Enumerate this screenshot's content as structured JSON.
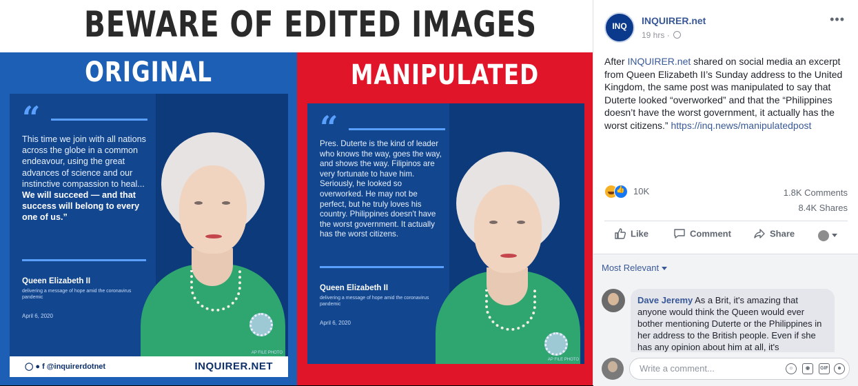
{
  "image": {
    "headline": "BEWARE OF EDITED IMAGES",
    "original_label": "ORIGINAL",
    "manipulated_label": "MANIPULATED",
    "original_card": {
      "quote_plain": "This time we join with all nations across the globe in a common endeavour, using the great advances of science and our instinctive compassion to heal...",
      "quote_bold": "We will succeed — and that success will belong to every one of us.”",
      "name": "Queen Elizabeth II",
      "subtitle": "delivering a message of hope amid the coronavirus pandemic",
      "date": "April 6, 2020",
      "credit": "AP FILE PHOTO"
    },
    "manipulated_card": {
      "quote_plain": "Pres. Duterte is the kind of leader who knows the way, goes the way, and shows the way. Filipinos are very fortunate to have him. Seriously, he looked so overworked. He may not be perfect, but he truly loves his country. Philippines doesn't have the worst government. It actually has the worst citizens.",
      "name": "Queen Elizabeth II",
      "subtitle": "delivering a message of hope amid the coronavirus pandemic",
      "date": "April 6, 2020",
      "credit": "AP FILE PHOTO"
    },
    "footer": {
      "handle": "@inquirerdotnet",
      "brand": "INQUIRER.NET"
    },
    "colors": {
      "original_bg": "#1c5fb4",
      "manipulated_bg": "#e0152a",
      "dress": "#2fa56f"
    }
  },
  "post": {
    "avatar_text": "INQ",
    "page_name": "INQUIRER.net",
    "time": "19 hrs",
    "text_pre": "After ",
    "text_link": "INQUIRER.net",
    "text_body": " shared on social media an excerpt from Queen Elizabeth II’s Sunday address to the United Kingdom, the same post was manipulated to say that Duterte looked “overworked” and that the “Philippines doesn’t have the worst government, it actually has the worst citizens.” ",
    "url": "https://inq.news/manipulatedpost",
    "reactions_count": "10K",
    "comments_count": "1.8K Comments",
    "shares_count": "8.4K Shares",
    "actions": {
      "like": "Like",
      "comment": "Comment",
      "share": "Share"
    },
    "sort_label": "Most Relevant",
    "comment": {
      "author": "Dave Jeremy",
      "text": " As a Brit, it's amazing that anyone would think the Queen would ever bother mentioning Duterte or the Philippines in her address to the British people. Even if she has any opinion about him at all, it's"
    },
    "write_placeholder": "Write a comment...",
    "colors": {
      "link": "#385898",
      "muted": "#606770"
    }
  }
}
